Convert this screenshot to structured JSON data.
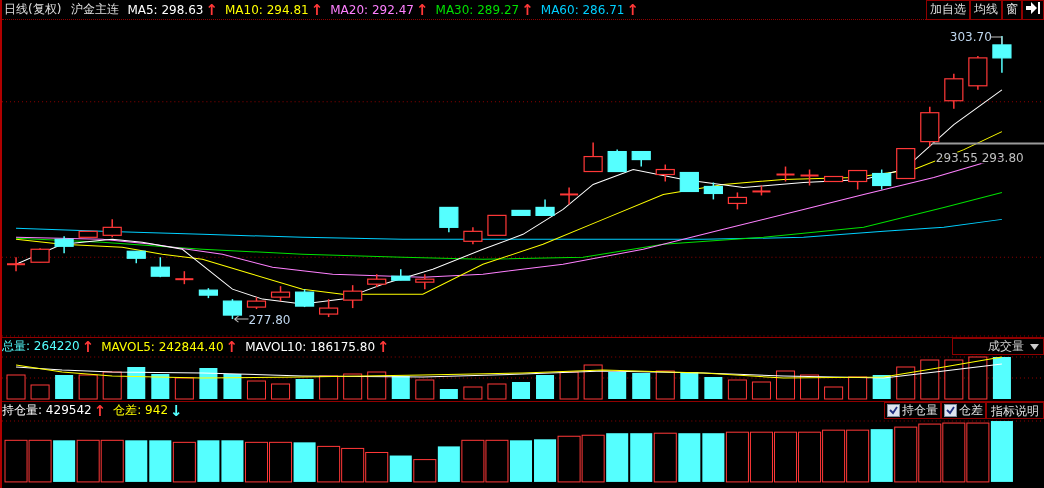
{
  "header": {
    "period": "日线(复权)",
    "symbol": "沪金主连",
    "indicators": [
      {
        "label": "MA5: 298.63",
        "color": "#ffffff",
        "trend": {
          "symbol": "↑",
          "color": "#ff3838"
        }
      },
      {
        "label": "MA10: 294.81",
        "color": "#ffff00",
        "trend": {
          "symbol": "↑",
          "color": "#ff3838"
        }
      },
      {
        "label": "MA20: 292.47",
        "color": "#ff80ff",
        "trend": {
          "symbol": "↑",
          "color": "#ff3838"
        }
      },
      {
        "label": "MA30: 289.27",
        "color": "#00e000",
        "trend": {
          "symbol": "↑",
          "color": "#ff3838"
        }
      },
      {
        "label": "MA60: 286.71",
        "color": "#00d0ff",
        "trend": {
          "symbol": "↑",
          "color": "#ff3838"
        }
      }
    ],
    "buttons": [
      {
        "label": "加自选"
      },
      {
        "label": "均线"
      },
      {
        "label": "窗"
      }
    ]
  },
  "price_labels": {
    "high": "303.70",
    "low": "277.80",
    "line": "293.55 293.80"
  },
  "volume_pane": {
    "indicators": [
      {
        "label": "总量: 264220",
        "color": "#55ffff",
        "trend": {
          "symbol": "↑",
          "color": "#ff3838"
        }
      },
      {
        "label": "MAVOL5: 242844.40",
        "color": "#ffff00",
        "trend": {
          "symbol": "↑",
          "color": "#ff3838"
        }
      },
      {
        "label": "MAVOL10: 186175.80",
        "color": "#ffffff",
        "trend": {
          "symbol": "↑",
          "color": "#ff3838"
        }
      }
    ],
    "dropdown": "成交量"
  },
  "open_interest_pane": {
    "indicators": [
      {
        "label": "持仓量: 429542",
        "color": "#ffffff",
        "trend": {
          "symbol": "↑",
          "color": "#ff3838"
        }
      },
      {
        "label": "仓差: 942",
        "color": "#ffff00",
        "trend": {
          "symbol": "↓",
          "color": "#55ffff"
        }
      }
    ],
    "checkboxes": [
      {
        "label": "持仓量",
        "checked": true
      },
      {
        "label": "仓差",
        "checked": true
      }
    ],
    "button": "指标说明"
  }
}
